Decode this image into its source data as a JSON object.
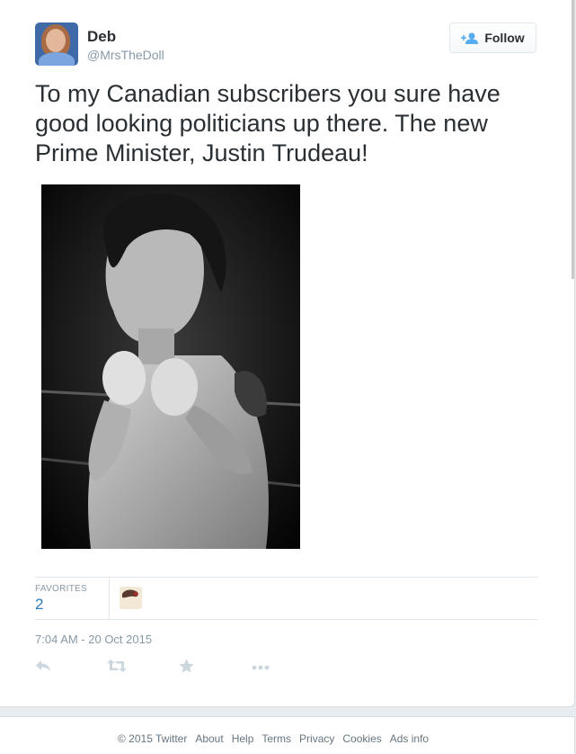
{
  "user": {
    "name": "Deb",
    "handle": "@MrsTheDoll"
  },
  "follow_button": {
    "label": "Follow",
    "icon": "add-user-icon"
  },
  "tweet": {
    "text": "To my Canadian subscribers you sure have good looking politicians up there. The new Prime Minister, Justin Trudeau!",
    "photo_icon": "photo-black-and-white"
  },
  "stats": {
    "favorites_label": "FAVORITES",
    "favorites_count": "2"
  },
  "timestamp": "7:04 AM - 20 Oct 2015",
  "actions": [
    {
      "icon": "reply-icon"
    },
    {
      "icon": "retweet-icon"
    },
    {
      "icon": "favorite-star-icon"
    },
    {
      "icon": "more-dots-icon"
    }
  ],
  "footer": {
    "copyright": "© 2015 Twitter",
    "links": [
      "About",
      "Help",
      "Terms",
      "Privacy",
      "Cookies",
      "Ads info"
    ]
  },
  "colors": {
    "link_blue": "#2b7bb9",
    "muted_gray": "#8899a6",
    "icon_gray": "#ccd6dd",
    "follow_icon_blue": "#55acee"
  }
}
